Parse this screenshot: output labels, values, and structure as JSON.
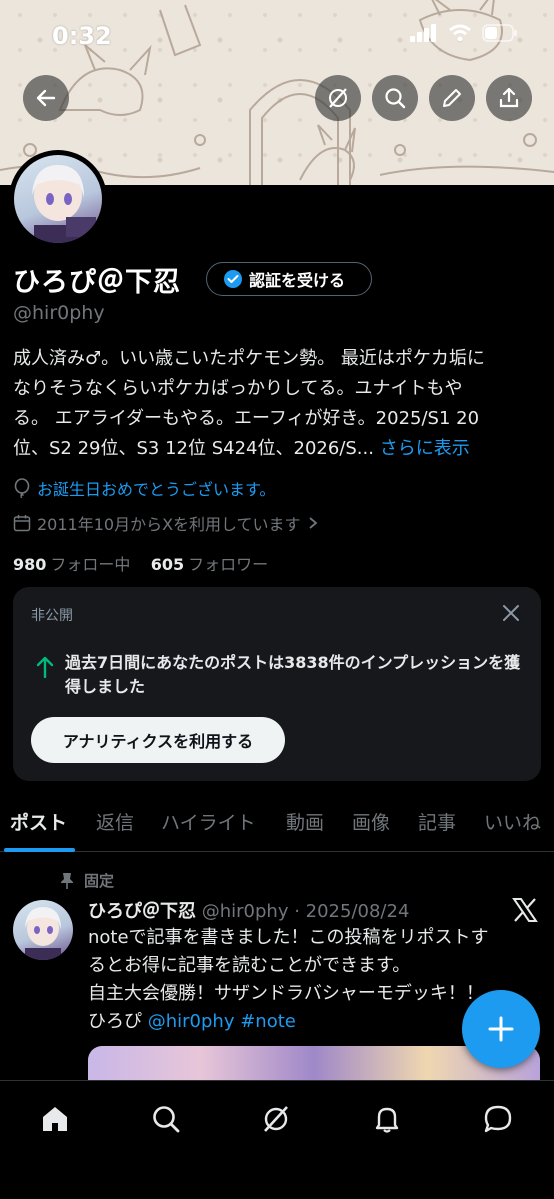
{
  "status_bar": {
    "time": "0:32"
  },
  "profile": {
    "name": "ひろぴ＠下忍",
    "verify_label": "認証を受ける",
    "handle": "@hir0phy",
    "bio_lines": [
      "成人済み♂。いい歳こいたポケモン勢。 最近はポケカ垢に",
      "なりそうなくらいポケカばっかりしてる。ユナイトもや",
      "る。 エアライダーもやる。エーフィが好き。2025/S1 20",
      "位、S2 29位、S3 12位 S424位、2026/S... "
    ],
    "bio_more": "さらに表示",
    "birthday": "お誕生日おめでとうございます。",
    "joined": "2011年10月からXを利用しています",
    "following_count": "980",
    "following_label": "フォロー中",
    "followers_count": "605",
    "followers_label": "フォロワー"
  },
  "analytics_card": {
    "private_label": "非公開",
    "impressions_text": "過去7日間にあなたのポストは3838件のインプレッションを獲得しました",
    "button_label": "アナリティクスを利用する"
  },
  "tabs": [
    "ポスト",
    "返信",
    "ハイライト",
    "動画",
    "画像",
    "記事",
    "いいね"
  ],
  "post": {
    "pinned_label": "固定",
    "name": "ひろぴ＠下忍",
    "handle_date": "@hir0phy · 2025/08/24",
    "text_lines": [
      "noteで記事を書きました！この投稿をリポストす",
      "るとお得に記事を読むことができます。",
      "自主大会優勝！サザンドラバシャーモデッキ！！"
    ],
    "text_prefix": "ひろぴ ",
    "mention": "@hir0phy",
    "hashtag": "#note"
  },
  "colors": {
    "accent": "#1d9bf0",
    "background": "#000000",
    "secondary_text": "#71767b"
  }
}
